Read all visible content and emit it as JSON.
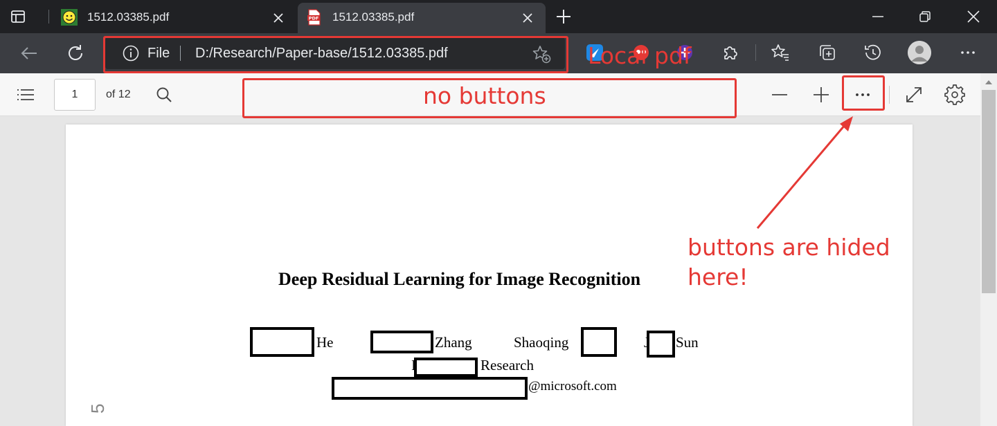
{
  "browser": {
    "tabs": [
      {
        "title": "1512.03385.pdf",
        "favicon": "smiley-icon",
        "active": false
      },
      {
        "title": "1512.03385.pdf",
        "favicon": "pdf-file-icon",
        "active": true
      }
    ],
    "address": {
      "scheme_label": "File",
      "url": "D:/Research/Paper-base/1512.03385.pdf"
    }
  },
  "pdf_toolbar": {
    "page_current": "1",
    "page_total_label": "of 12"
  },
  "document": {
    "title": "Deep Residual Learning for Image Recognition",
    "authors": {
      "a1": "He",
      "a2": "Zhang",
      "a3": "Shaoqing",
      "a4": "J",
      "a5": "Sun"
    },
    "affil_prefix": "I",
    "affiliation_tail": "Research",
    "email_domain": "@microsoft.com",
    "margin_stamp": "5"
  },
  "annotations": {
    "address_note": "Local pdf",
    "toolbar_note": "no buttons",
    "hidden_note_line1": "buttons are hided",
    "hidden_note_line2": "here!",
    "color": "#e53935"
  }
}
